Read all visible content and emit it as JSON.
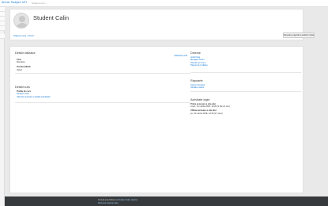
{
  "topbar": {
    "site_name": "Arti de Tiudipev IuTI",
    "course_crumb": "Student curs ›"
  },
  "header": {
    "student_name": "Student Calin",
    "breadcrumb": "Pagina mea › Profil",
    "reset_button": "Resetare pagină la setările inițiale"
  },
  "user_details": {
    "title": "Detalii utilizator",
    "edit_link": "Editează profil",
    "country_label": "Țară",
    "country_value": "România",
    "city_label": "Oraș/localitate",
    "city_value": "Vaslui"
  },
  "course_details": {
    "title": "Detalii curs",
    "profiles_label": "Profile de curs",
    "links": [
      "Student retea",
      "Ultimele accesari si detalii activitatilor"
    ]
  },
  "misc": {
    "title": "Diverse",
    "links": [
      "Intrări blog",
      "Mesajele forum",
      "Discuții pe forum",
      "Planuri de învățare"
    ]
  },
  "reports": {
    "title": "Rapoarte",
    "links": [
      "Sesiuni browser",
      "Situația notelor"
    ]
  },
  "login_activity": {
    "title": "Activitate login",
    "first_label": "Prima accesare a site-ului",
    "first_value": "vineri, 14 martie 2018, 14:26 (9 zile 21 min)",
    "last_label": "Ultima accesare a site-ului",
    "last_value": "joi, 24 martie 2018, 13:45 (17 secs)"
  },
  "footer": {
    "logged_in_prefix": "Sunteți autentificat ca",
    "user_name": "Student Calin (Ieșire)",
    "summary_link": "Rezumat retentie date"
  },
  "colors": {
    "link": "#1177d1",
    "footer_bg": "#373a3c",
    "page_bg": "#e9e9e9"
  }
}
